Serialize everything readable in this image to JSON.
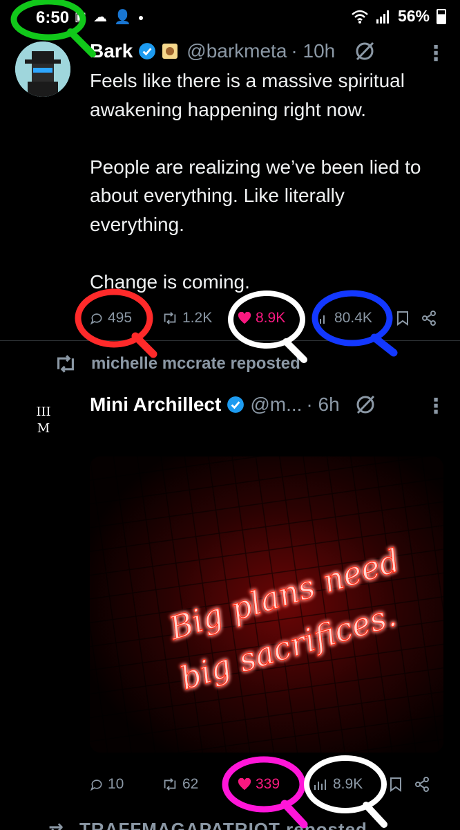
{
  "status_bar": {
    "time": "6:50",
    "battery": "56%"
  },
  "tweet1": {
    "name": "Bark",
    "handle": "@barkmeta",
    "time": "· 10h",
    "paragraphs": [
      "Feels like there is a massive spiritual awakening happening right now.",
      "People are realizing we’ve been lied to about everything. Like literally everything.",
      "Change is coming."
    ],
    "replies": "495",
    "reposts": "1.2K",
    "likes": "8.9K",
    "views": "80.4K"
  },
  "repost_line": "michelle mccrate reposted",
  "tweet2": {
    "name": "Mini Archillect",
    "handle": "@m...",
    "time": "· 6h",
    "avatar_text": "III\nM",
    "image_text_line1": "Big plans need",
    "image_text_line2": "big sacrifices.",
    "replies": "10",
    "reposts": "62",
    "likes": "339",
    "views": "8.9K"
  },
  "next_repost_line": "TRAFFMAGAPATRIOT reposted",
  "colors": {
    "accent": "#1d9bf0",
    "like": "#f91880",
    "annot_green": "#11c81a",
    "annot_red": "#ff2a2a",
    "annot_white": "#ffffff",
    "annot_blue": "#1338ff",
    "annot_magenta": "#ff16d8"
  }
}
